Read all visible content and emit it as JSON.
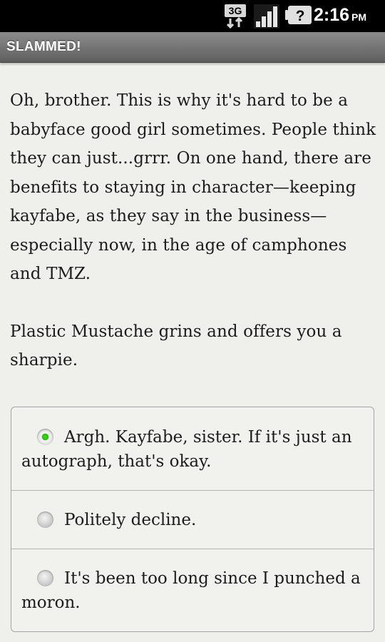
{
  "status_bar": {
    "network_label": "3G",
    "time": "2:16",
    "ampm": "PM",
    "icons": [
      "network-3g-icon",
      "signal-strength-icon",
      "battery-unknown-icon"
    ]
  },
  "title_bar": {
    "title": "SLAMMED!"
  },
  "passage": {
    "paragraphs": [
      "Oh, brother. This is why it's hard to be a babyface good girl sometimes. People think they can just...grrr. On one hand, there are benefits to staying in character—keeping kayfabe, as they say in the business—especially now, in the age of camphones and TMZ.",
      "Plastic Mustache grins and offers you a sharpie."
    ]
  },
  "choices": {
    "items": [
      {
        "label": "Argh. Kayfabe, sister. If it's just an autograph, that's okay.",
        "selected": true
      },
      {
        "label": "Politely decline.",
        "selected": false
      },
      {
        "label": "It's been too long since I punched a moron.",
        "selected": false
      }
    ]
  },
  "colors": {
    "selected_radio": "#27b30f",
    "title_bar": "#6f6f6f",
    "background": "#efefeb"
  }
}
